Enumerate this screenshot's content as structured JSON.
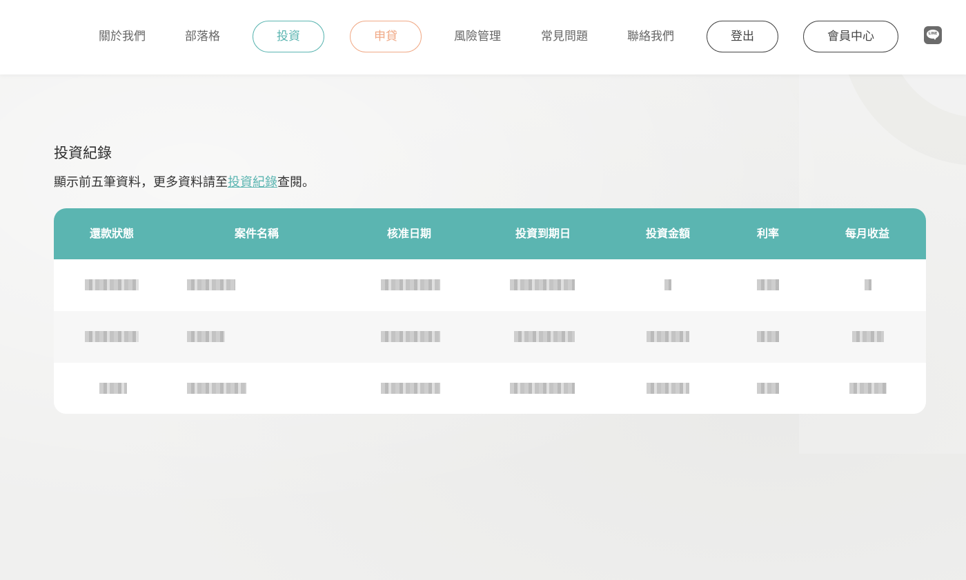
{
  "nav": {
    "about": "關於我們",
    "blog": "部落格",
    "invest": "投資",
    "loan": "申貸",
    "risk": "風險管理",
    "faq": "常見問題",
    "contact": "聯絡我們",
    "logout": "登出",
    "member": "會員中心",
    "line_icon": "LINE"
  },
  "colors": {
    "accent_teal": "#5bb5b1",
    "accent_orange": "#f0a986",
    "dark_outline": "#444444"
  },
  "section": {
    "title": "投資紀錄",
    "desc_before": "顯示前五筆資料，更多資料請至",
    "desc_link": "投資紀錄",
    "desc_after": "查閱。"
  },
  "table": {
    "headers": [
      "還款狀態",
      "案件名稱",
      "核准日期",
      "投資到期日",
      "投資金額",
      "利率",
      "每月收益"
    ]
  }
}
